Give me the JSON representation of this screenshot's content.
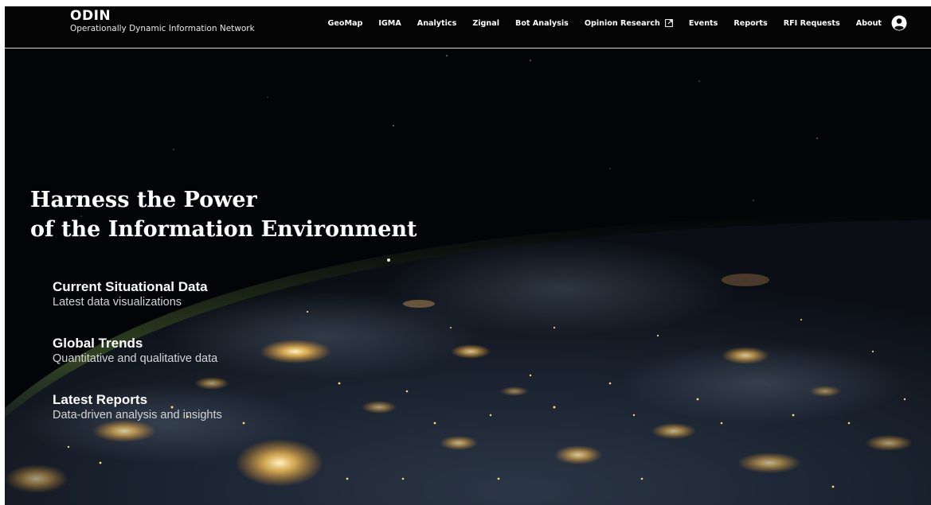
{
  "brand": {
    "title": "ODIN",
    "subtitle": "Operationally Dynamic Information Network"
  },
  "nav": {
    "items": [
      {
        "label": "GeoMap"
      },
      {
        "label": "IGMA"
      },
      {
        "label": "Analytics"
      },
      {
        "label": "Zignal"
      },
      {
        "label": "Bot Analysis"
      },
      {
        "label": "Opinion Research",
        "icon": "external-link-icon"
      },
      {
        "label": "Events"
      },
      {
        "label": "Reports"
      },
      {
        "label": "RFI Requests"
      },
      {
        "label": "About"
      }
    ],
    "user_icon": "user-circle-icon"
  },
  "hero": {
    "headline_line1": "Harness the Power",
    "headline_line2": "of the Information Environment",
    "background": "earth-at-night-from-space",
    "features": [
      {
        "title": "Current Situational Data",
        "description": "Latest data visualizations"
      },
      {
        "title": "Global Trends",
        "description": "Quantitative and qualitative data"
      },
      {
        "title": "Latest Reports",
        "description": "Data-driven analysis and insights"
      }
    ]
  },
  "colors": {
    "header_bg": "#040404",
    "header_border": "#d8d8d8",
    "text": "#ffffff",
    "city_lights": "#ffcf6b"
  }
}
